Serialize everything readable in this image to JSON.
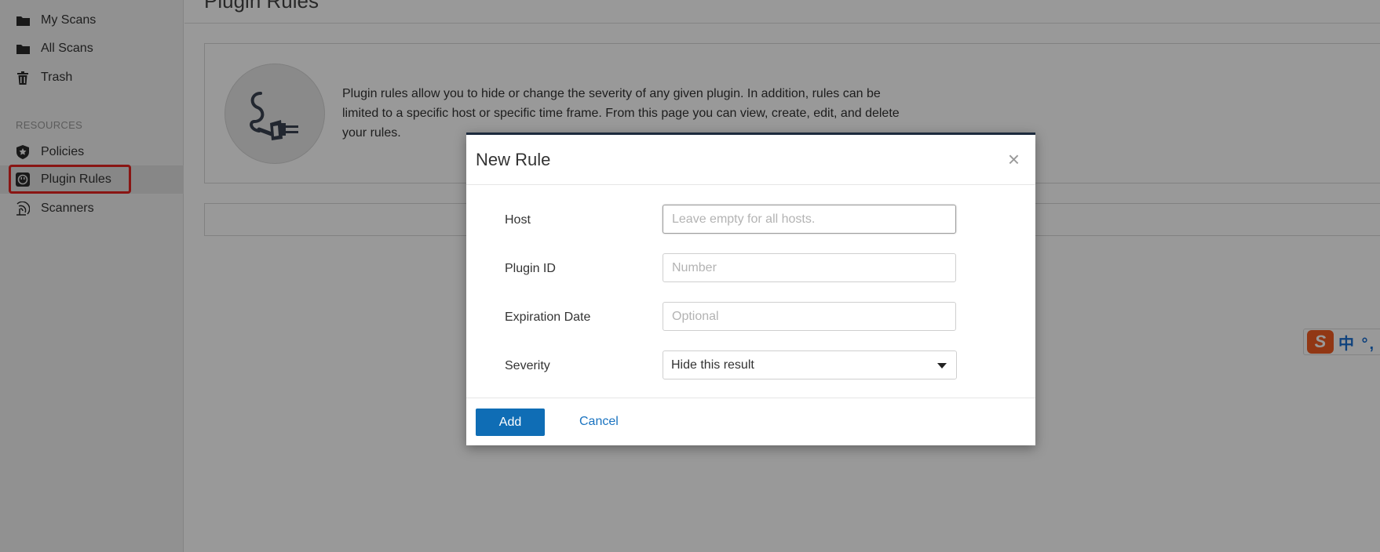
{
  "sidebar": {
    "items": [
      {
        "label": "My Scans",
        "icon": "folder-icon"
      },
      {
        "label": "All Scans",
        "icon": "folder-icon"
      },
      {
        "label": "Trash",
        "icon": "trash-icon"
      }
    ],
    "resources_label": "RESOURCES",
    "resources": [
      {
        "label": "Policies",
        "icon": "shield-icon"
      },
      {
        "label": "Plugin Rules",
        "icon": "plug-icon",
        "active": true
      },
      {
        "label": "Scanners",
        "icon": "radar-icon"
      }
    ]
  },
  "main": {
    "page_title": "Plugin Rules",
    "info_text": "Plugin rules allow you to hide or change the severity of any given plugin. In addition, rules can be limited to a specific host or specific time frame. From this page you can view, create, edit, and delete your rules."
  },
  "modal": {
    "title": "New Rule",
    "close_glyph": "×",
    "host": {
      "label": "Host",
      "placeholder": "Leave empty for all hosts.",
      "value": ""
    },
    "plugin_id": {
      "label": "Plugin ID",
      "placeholder": "Number",
      "value": ""
    },
    "expiration": {
      "label": "Expiration Date",
      "placeholder": "Optional",
      "value": ""
    },
    "severity": {
      "label": "Severity",
      "selected": "Hide this result"
    },
    "add_label": "Add",
    "cancel_label": "Cancel"
  },
  "ime": {
    "logo": "S",
    "text": "中 °, ("
  },
  "colors": {
    "primary_button": "#0f6db5",
    "link": "#1a73c0",
    "highlight": "#e52420",
    "modal_top_border": "#1c2a3d"
  }
}
